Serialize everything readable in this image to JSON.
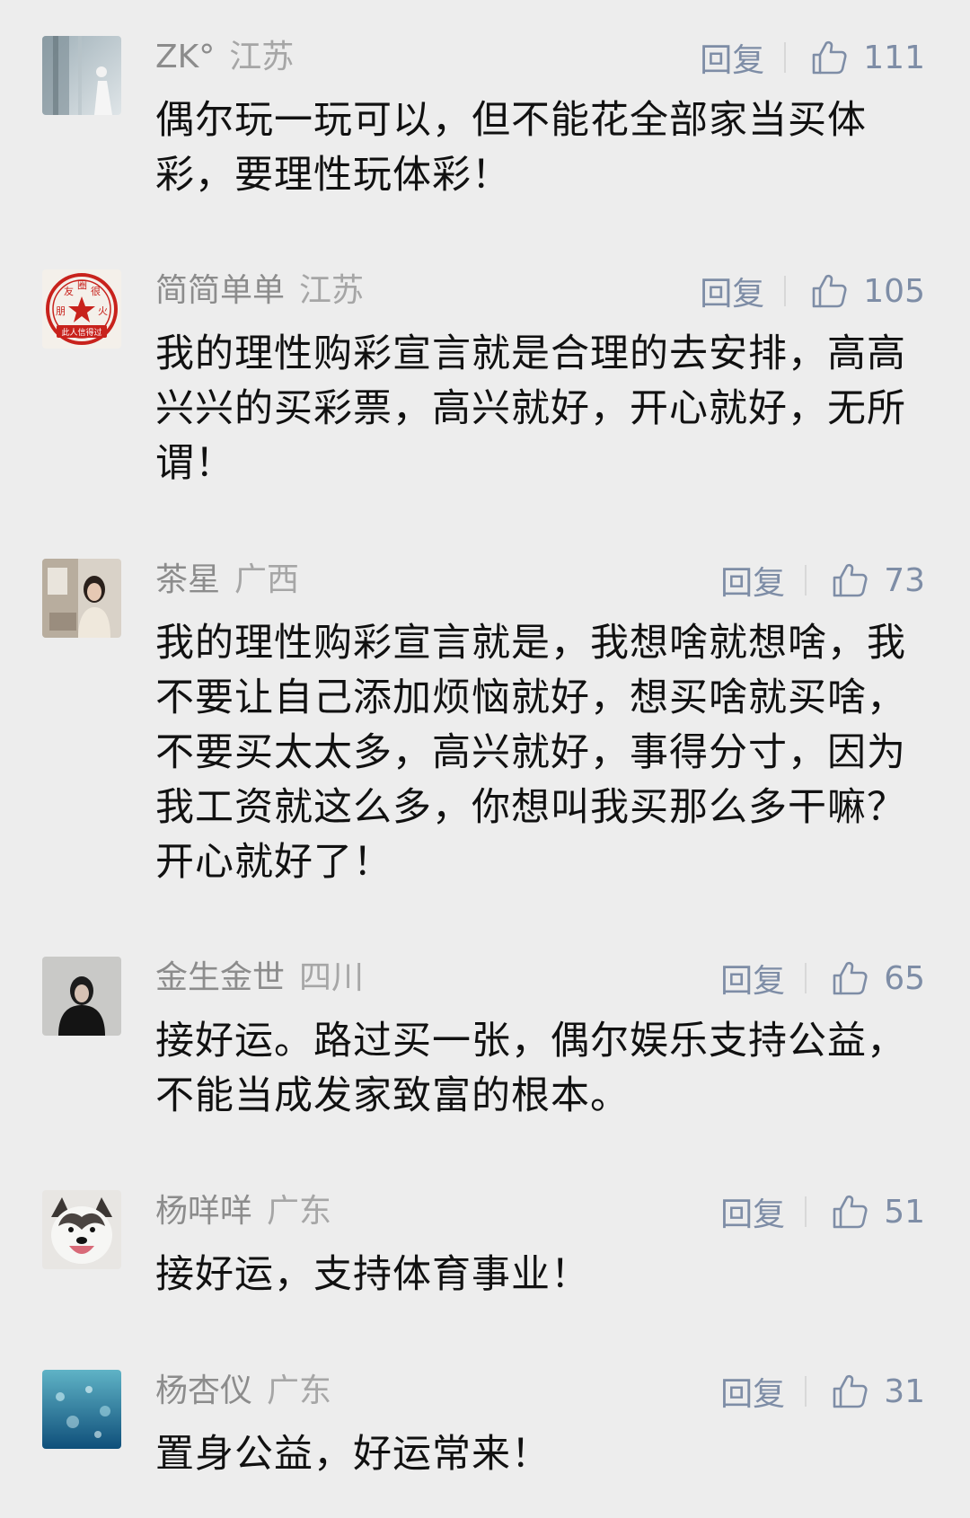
{
  "comments": [
    {
      "user": "ZK°",
      "location": "江苏",
      "reply_label": "回复",
      "likes": "111",
      "text": "偶尔玩一玩可以，但不能花全部家当买体彩，要理性玩体彩！",
      "avatar": "photo-avatar"
    },
    {
      "user": "简简单单",
      "location": "江苏",
      "reply_label": "回复",
      "likes": "105",
      "text": "我的理性购彩宣言就是合理的去安排，高高兴兴的买彩票，高兴就好，开心就好，无所谓！",
      "avatar": "stamp-avatar",
      "avatar_stamp": {
        "top_left": "友",
        "top": "圈",
        "top_right": "很",
        "left": "朋",
        "right": "火",
        "bottom": "此人信得过"
      }
    },
    {
      "user": "茶星",
      "location": "广西",
      "reply_label": "回复",
      "likes": "73",
      "text": "我的理性购彩宣言就是，我想啥就想啥，我不要让自己添加烦恼就好，想买啥就买啥，不要买太太多，高兴就好，事得分寸，因为我工资就这么多，你想叫我买那么多干嘛？开心就好了！",
      "avatar": "photo-avatar"
    },
    {
      "user": "金生金世",
      "location": "四川",
      "reply_label": "回复",
      "likes": "65",
      "text": "接好运。路过买一张，偶尔娱乐支持公益，不能当成发家致富的根本。",
      "avatar": "photo-avatar"
    },
    {
      "user": "杨咩咩",
      "location": "广东",
      "reply_label": "回复",
      "likes": "51",
      "text": "接好运，支持体育事业！",
      "avatar": "dog-avatar"
    },
    {
      "user": "杨杏仪",
      "location": "广东",
      "reply_label": "回复",
      "likes": "31",
      "text": "置身公益，好运常来！",
      "avatar": "sea-avatar"
    }
  ],
  "colors": {
    "background": "#ededed",
    "meta": "#8c8c8c",
    "action": "#7e8da6",
    "text": "#111111"
  },
  "icons": {
    "like": "thumbs-up-icon"
  }
}
